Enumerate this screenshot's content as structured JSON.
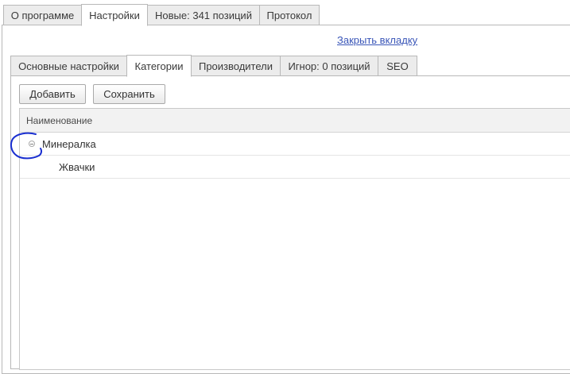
{
  "top_tabs": [
    {
      "label": "О программе",
      "active": false
    },
    {
      "label": "Настройки",
      "active": true
    },
    {
      "label": "Новые: 341 позиций",
      "active": false
    },
    {
      "label": "Протокол",
      "active": false
    }
  ],
  "close_tab_link": "Закрыть вкладку",
  "settings_tabs": [
    {
      "label": "Основные настройки",
      "active": false
    },
    {
      "label": "Категории",
      "active": true
    },
    {
      "label": "Производители",
      "active": false
    },
    {
      "label": "Игнор: 0 позиций",
      "active": false
    },
    {
      "label": "SEO",
      "active": false
    }
  ],
  "toolbar": {
    "add_label": "Добавить",
    "save_label": "Сохранить"
  },
  "grid": {
    "column_header": "Наименование",
    "rows": [
      {
        "label": "Минералка",
        "expanded": true,
        "level": 0
      },
      {
        "label": "Жвачки",
        "level": 1
      }
    ]
  },
  "colors": {
    "link": "#3a56b8",
    "annotation": "#1a2fd0",
    "border": "#b8b8b8"
  }
}
